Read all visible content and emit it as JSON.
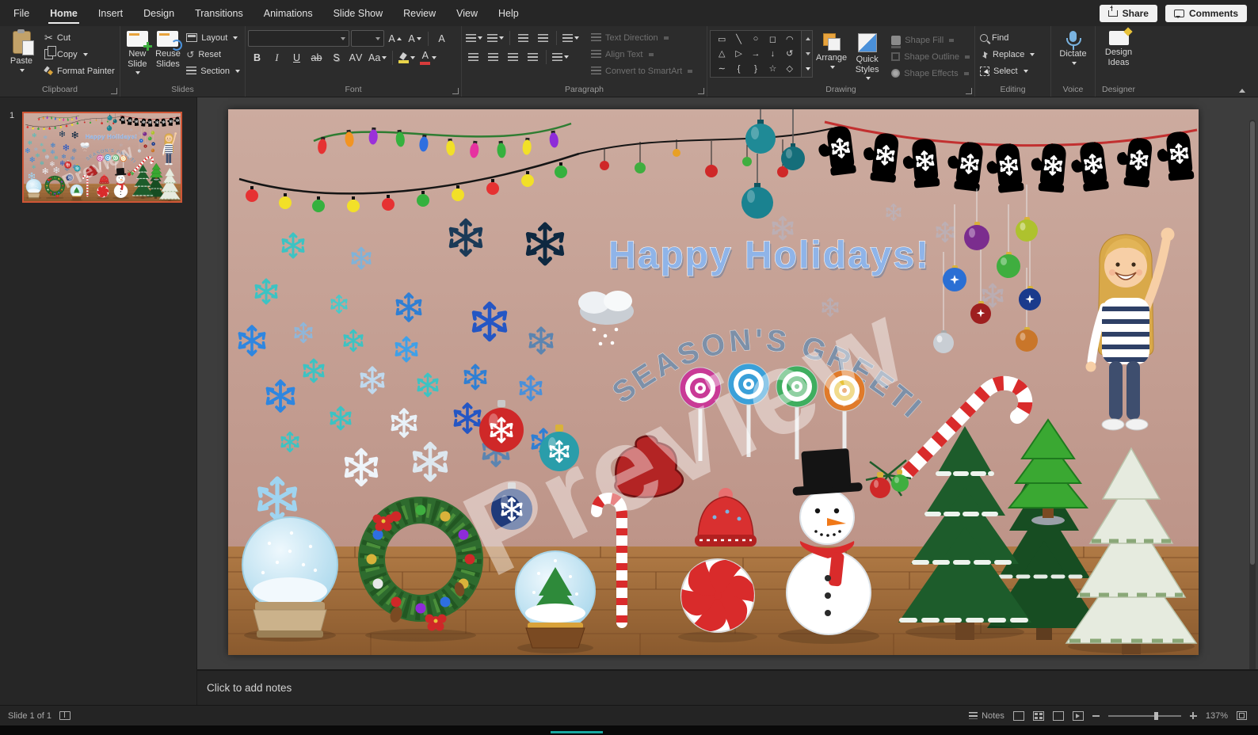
{
  "window": {
    "share": "Share",
    "comments": "Comments"
  },
  "tabs": {
    "file": "File",
    "home": "Home",
    "insert": "Insert",
    "design": "Design",
    "transitions": "Transitions",
    "animations": "Animations",
    "slideshow": "Slide Show",
    "review": "Review",
    "view": "View",
    "help": "Help"
  },
  "ribbon": {
    "clipboard": {
      "label": "Clipboard",
      "paste": "Paste",
      "cut": "Cut",
      "copy": "Copy",
      "format_painter": "Format Painter"
    },
    "slides": {
      "label": "Slides",
      "new_slide": "New Slide",
      "reuse_slides": "Reuse Slides",
      "layout": "Layout",
      "reset": "Reset",
      "section": "Section"
    },
    "font": {
      "label": "Font",
      "bold": "B",
      "italic": "I",
      "underline": "U",
      "strike": "ab",
      "shadow": "S",
      "spacing": "AV",
      "case": "Aa",
      "grow": "A",
      "shrink": "A",
      "clear": "A",
      "color_a": "A"
    },
    "paragraph": {
      "label": "Paragraph",
      "text_direction": "Text Direction",
      "align_text": "Align Text",
      "smartart": "Convert to SmartArt"
    },
    "drawing": {
      "label": "Drawing",
      "arrange": "Arrange",
      "quick_styles": "Quick Styles",
      "shape_fill": "Shape Fill",
      "shape_outline": "Shape Outline",
      "shape_effects": "Shape Effects",
      "shapes": [
        "▭",
        "╲",
        "○",
        "◻",
        "◠",
        "△",
        "▷",
        "→",
        "↓",
        "↺",
        "∼",
        "{",
        "}",
        "☆",
        "◇"
      ]
    },
    "editing": {
      "label": "Editing",
      "find": "Find",
      "replace": "Replace",
      "select": "Select"
    },
    "voice": {
      "label": "Voice",
      "dictate": "Dictate"
    },
    "designer": {
      "label": "Designer",
      "design_ideas": "Design Ideas"
    }
  },
  "slide_panel": {
    "number": "1"
  },
  "slide": {
    "title": "Happy Holidays!",
    "greeting": "SEASON'S  GREETINGS",
    "watermark": "Preview"
  },
  "notes": {
    "placeholder": "Click to add notes"
  },
  "statusbar": {
    "slide_indicator": "Slide 1 of 1",
    "notes": "Notes",
    "zoom": "137%"
  }
}
